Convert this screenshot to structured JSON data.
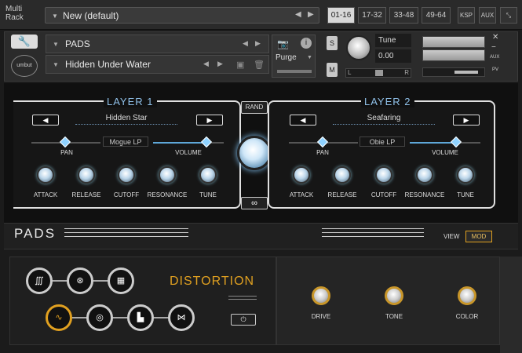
{
  "topbar": {
    "multi_rack": "Multi\nRack",
    "preset_name": "New (default)",
    "ranges": [
      "01-16",
      "17-32",
      "33-48",
      "49-64"
    ],
    "active_range": "01-16",
    "ksp": "KSP",
    "aux": "AUX"
  },
  "instrument": {
    "name": "PADS",
    "snapshot": "Hidden Under Water",
    "purge": "Purge",
    "solo": "S",
    "mute": "M",
    "tune_label": "Tune",
    "tune_value": "0.00",
    "pan_left": "L",
    "pan_right": "R",
    "aux_label": "AUX",
    "pv_label": "PV"
  },
  "layer1": {
    "title": "LAYER 1",
    "preset": "Hidden Star",
    "filter": "Mogue LP",
    "pan_label": "PAN",
    "volume_label": "VOLUME",
    "knobs": [
      "ATTACK",
      "RELEASE",
      "CUTOFF",
      "RESONANCE",
      "TUNE"
    ]
  },
  "layer2": {
    "title": "LAYER 2",
    "preset": "Seafaring",
    "filter": "Obie LP",
    "pan_label": "PAN",
    "volume_label": "VOLUME",
    "knobs": [
      "ATTACK",
      "RELEASE",
      "CUTOFF",
      "RESONANCE",
      "TUNE"
    ]
  },
  "center": {
    "rand": "RAND",
    "link": "∞"
  },
  "pads_bar": {
    "title": "PADS",
    "view": "VIEW",
    "mod": "MOD"
  },
  "effects": {
    "title": "DISTORTION",
    "power": "⏻",
    "knobs": [
      "DRIVE",
      "TONE",
      "COLOR"
    ]
  }
}
